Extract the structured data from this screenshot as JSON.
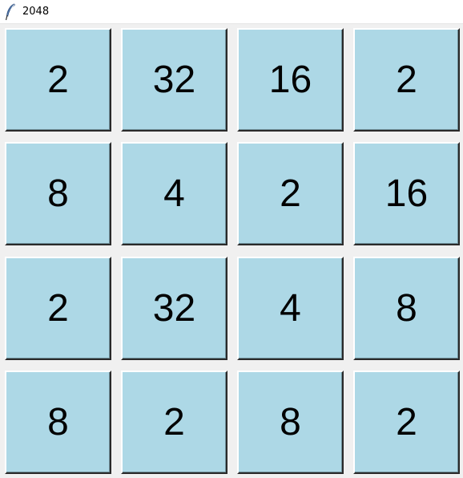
{
  "window": {
    "title": "2048",
    "icon": "feather-icon"
  },
  "board": {
    "rows": [
      [
        "2",
        "32",
        "16",
        "2"
      ],
      [
        "8",
        "4",
        "2",
        "16"
      ],
      [
        "2",
        "32",
        "4",
        "8"
      ],
      [
        "8",
        "2",
        "8",
        "2"
      ]
    ]
  },
  "colors": {
    "tile_background": "#add8e6",
    "window_background": "#f0f0f0",
    "titlebar_background": "#ffffff",
    "tile_text": "#000000"
  }
}
